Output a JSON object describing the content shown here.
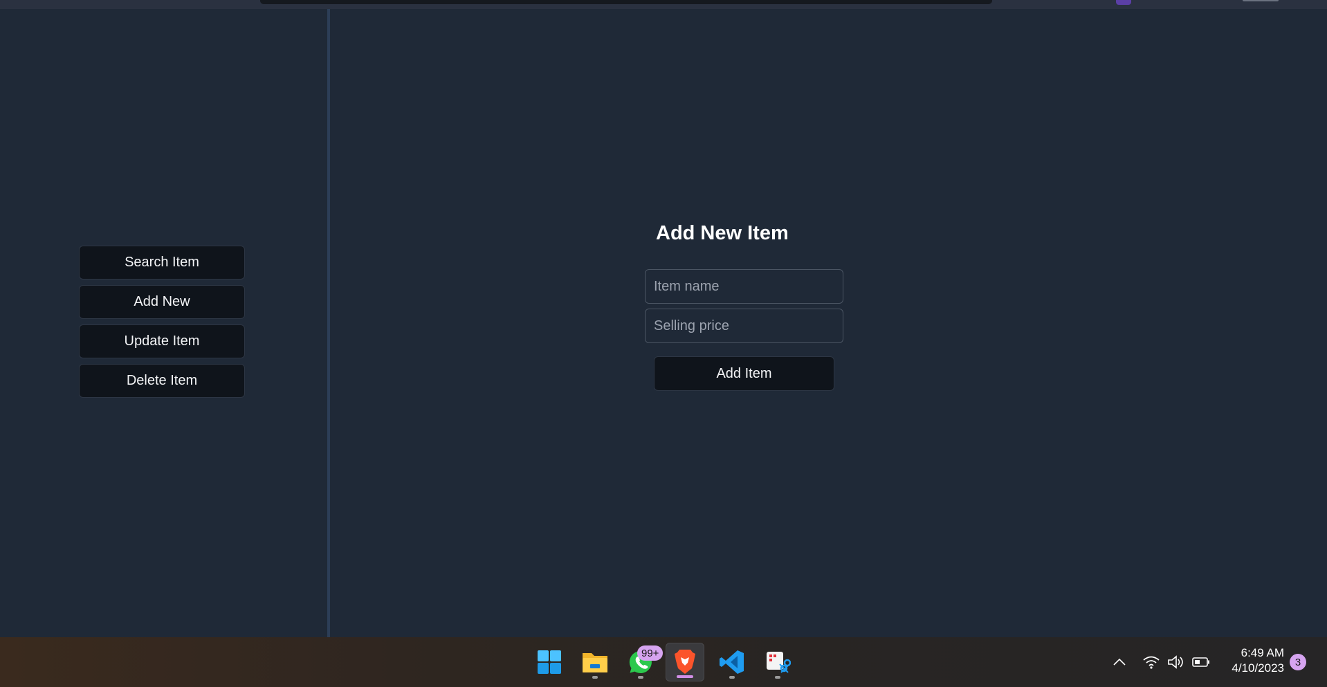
{
  "sidebar": {
    "items": [
      {
        "label": "Search Item"
      },
      {
        "label": "Add New"
      },
      {
        "label": "Update Item"
      },
      {
        "label": "Delete Item"
      }
    ]
  },
  "form": {
    "title": "Add New Item",
    "item_name": {
      "value": "",
      "placeholder": "Item name"
    },
    "selling_price": {
      "value": "",
      "placeholder": "Selling price"
    },
    "submit_label": "Add Item"
  },
  "taskbar": {
    "apps": [
      {
        "icon": "windows-start-icon",
        "active": false
      },
      {
        "icon": "file-explorer-icon",
        "active": false
      },
      {
        "icon": "whatsapp-icon",
        "active": false
      },
      {
        "icon": "brave-browser-icon",
        "active": true
      },
      {
        "icon": "vscode-icon",
        "active": false
      },
      {
        "icon": "snipping-tool-icon",
        "active": false
      }
    ],
    "whatsapp_badge": "99+",
    "tray": {
      "icons": [
        "chevron-up-icon",
        "wifi-icon",
        "volume-icon",
        "battery-icon"
      ],
      "time": "6:49 AM",
      "date": "4/10/2023",
      "notification_count": "3"
    }
  },
  "colors": {
    "background": "#1f2937",
    "button_bg": "#0f141b",
    "sidebar_divider": "#2c3e57",
    "accent_badge": "#d6a4f0"
  }
}
